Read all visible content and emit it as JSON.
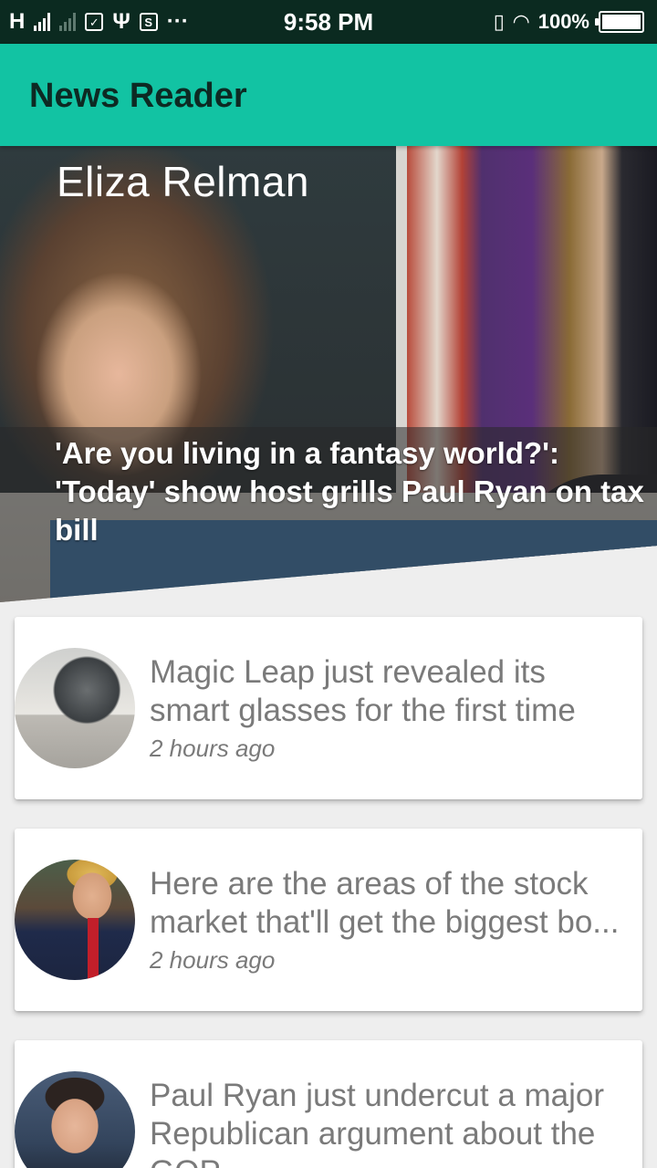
{
  "status_bar": {
    "carrier_1": "H",
    "time": "9:58 PM",
    "battery_level": 100,
    "battery_text": "100%",
    "icons": [
      "signal-icon",
      "signal-weak-icon",
      "checkbox-icon",
      "usb-icon",
      "screenshot-icon",
      "more-icon",
      "vibrate-icon",
      "wifi-icon",
      "battery-icon"
    ],
    "more_glyph": "···",
    "usb_glyph": "Ψ",
    "check_glyph": "✓",
    "screenshot_glyph": "S",
    "vibrate_glyph": "▯",
    "wifi_glyph": "◠"
  },
  "app_bar": {
    "title": "News Reader",
    "color": "#12c3a3"
  },
  "hero": {
    "author": "Eliza Relman",
    "headline": "'Are you living in a fantasy world?': 'Today' show host grills Paul Ryan on tax bill"
  },
  "articles": [
    {
      "title": "Magic Leap just revealed its smart glasses for the first time",
      "time": "2 hours ago"
    },
    {
      "title": "Here are the areas of the stock market that'll get the biggest bo...",
      "time": "2 hours ago"
    },
    {
      "title": "Paul Ryan just undercut a major Republican argument about the GOP...",
      "time": ""
    }
  ]
}
